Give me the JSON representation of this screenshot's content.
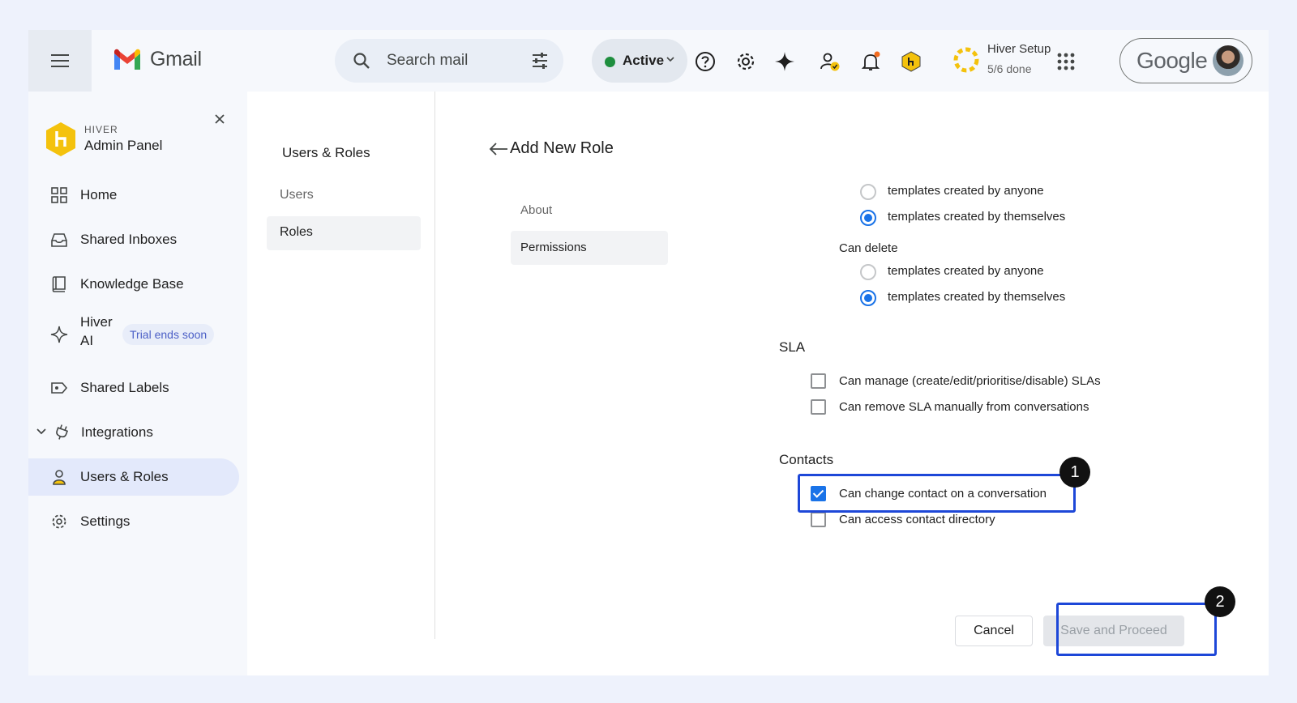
{
  "topbar": {
    "app_name": "Gmail",
    "search_placeholder": "Search mail",
    "status_label": "Active",
    "status_color": "#1e8e3e",
    "icons": [
      "menu-icon",
      "gmail-logo-icon",
      "search-icon",
      "tune-icon",
      "help-icon",
      "settings-icon",
      "gemini-sparkle-icon",
      "user-status-icon",
      "notification-bell-icon",
      "hiver-shield-icon",
      "apps-grid-icon"
    ],
    "setup": {
      "title": "Hiver Setup",
      "progress": "5/6 done",
      "progress_fraction": 0.833
    },
    "account_label": "Google"
  },
  "sidebar": {
    "brand_small": "HIVER",
    "brand_big": "Admin Panel",
    "items": [
      {
        "label": "Home",
        "icon": "home-grid-icon"
      },
      {
        "label": "Shared Inboxes",
        "icon": "inbox-icon"
      },
      {
        "label": "Knowledge Base",
        "icon": "book-icon"
      },
      {
        "label": "Hiver AI",
        "icon": "sparkle-icon",
        "badge": "Trial ends soon"
      },
      {
        "label": "Shared Labels",
        "icon": "label-share-icon"
      },
      {
        "label": "Integrations",
        "icon": "plug-icon"
      },
      {
        "label": "Users & Roles",
        "icon": "user-icon",
        "active": true
      },
      {
        "label": "Settings",
        "icon": "gear-icon"
      }
    ]
  },
  "users_roles": {
    "title": "Users & Roles",
    "items": [
      {
        "label": "Users"
      },
      {
        "label": "Roles",
        "active": true
      }
    ]
  },
  "main": {
    "title": "Add New Role",
    "subnav": [
      {
        "label": "About"
      },
      {
        "label": "Permissions",
        "active": true
      }
    ],
    "templates": {
      "edit_options": [
        {
          "label": "templates created by anyone",
          "checked": false
        },
        {
          "label": "templates created by themselves",
          "checked": true
        }
      ],
      "delete_label": "Can delete",
      "delete_options": [
        {
          "label": "templates created by anyone",
          "checked": false
        },
        {
          "label": "templates created by themselves",
          "checked": true
        }
      ]
    },
    "sla": {
      "title": "SLA",
      "options": [
        {
          "label": "Can manage (create/edit/prioritise/disable) SLAs",
          "checked": false
        },
        {
          "label": "Can remove SLA manually from conversations",
          "checked": false
        }
      ]
    },
    "contacts": {
      "title": "Contacts",
      "options": [
        {
          "label": "Can change contact on a conversation",
          "checked": true
        },
        {
          "label": "Can access contact directory",
          "checked": false
        }
      ]
    },
    "actions": {
      "cancel": "Cancel",
      "save": "Save and Proceed"
    },
    "steps": [
      "1",
      "2"
    ]
  }
}
